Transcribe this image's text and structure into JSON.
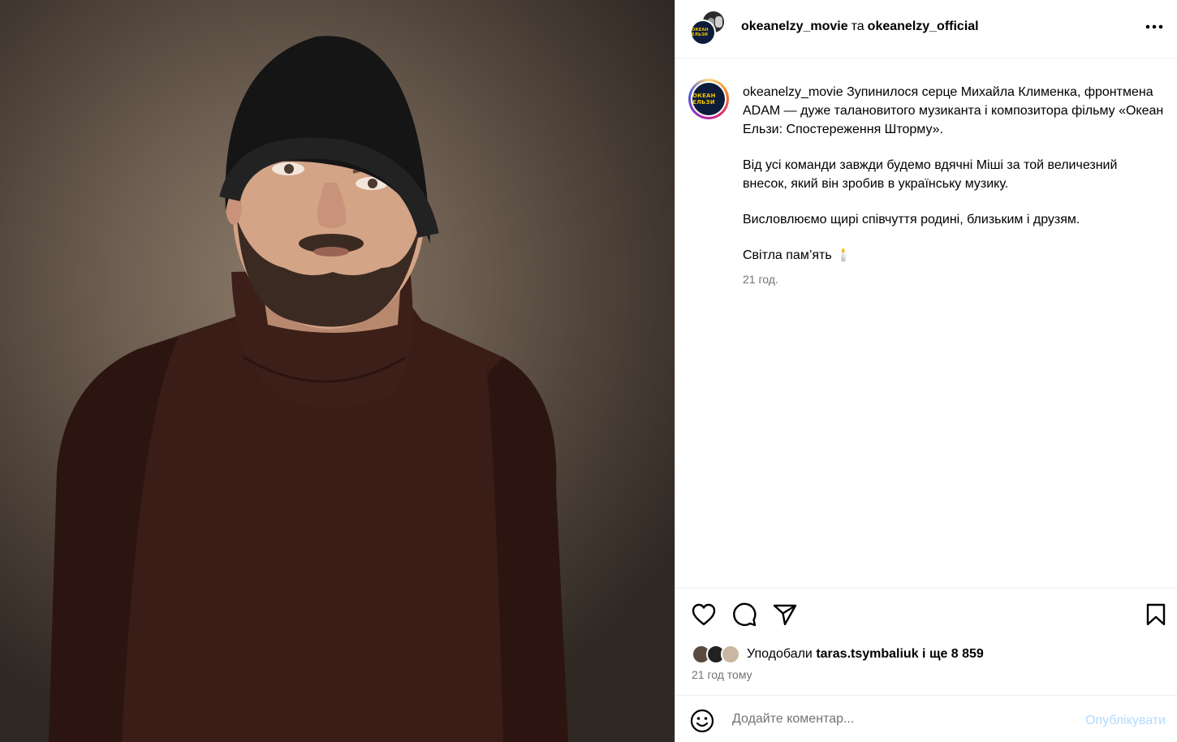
{
  "post": {
    "photo_description_icon": "portrait-photo",
    "header": {
      "author1": "okeanelzy_movie",
      "separator": "та",
      "author2": "okeanelzy_official",
      "more_icon": "more-horizontal-icon"
    },
    "avatar_logo_text": "ОКЕАН ЕЛЬЗИ",
    "caption": {
      "username": "okeanelzy_movie",
      "paragraph1": "Зупинилося серце Михайла Клименка, фронтмена ADAM — дуже талановитого музиканта і композитора фільму «Океан Ельзи: Спостереження Шторму».",
      "paragraph2": "Від усі команди завжди будемо вдячні Міші за той величезний внесок, який він зробив в українську музику.",
      "paragraph3": "Висловлюємо щирі співчуття родині, близьким і друзям.",
      "paragraph4": "Світла пам’ять 🕯️",
      "time": "21 год."
    },
    "actions": {
      "like_icon": "heart-icon",
      "comment_icon": "comment-icon",
      "share_icon": "share-icon",
      "save_icon": "bookmark-icon"
    },
    "likes": {
      "prefix": "Уподобали",
      "user": "taras.tsymbaliuk",
      "suffix": "і ще 8 859"
    },
    "post_time": "21 год тому",
    "comment": {
      "placeholder": "Додайте коментар...",
      "publish_label": "Опублікувати",
      "emoji_icon": "emoji-smile-icon"
    }
  }
}
